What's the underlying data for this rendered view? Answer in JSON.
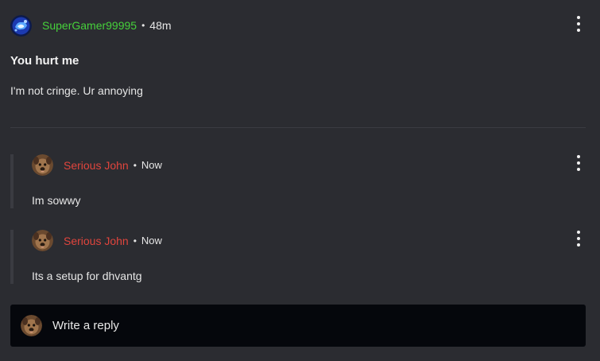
{
  "post": {
    "author": "SuperGamer99995",
    "separator": "•",
    "time": "48m",
    "title": "You hurt me",
    "body": "I'm not cringe. Ur annoying",
    "author_color": "#46d13b"
  },
  "replies": [
    {
      "author": "Serious John",
      "separator": "•",
      "time": "Now",
      "body": "Im sowwy",
      "author_color": "#e0453d"
    },
    {
      "author": "Serious John",
      "separator": "•",
      "time": "Now",
      "body": "Its a setup for dhvantg",
      "author_color": "#e0453d"
    }
  ],
  "reply_box": {
    "placeholder": "Write a reply"
  },
  "icons": {
    "menu": "more-vertical-icon",
    "op_avatar": "gamer-avatar-icon",
    "reply_avatar": "dog-avatar-icon"
  },
  "colors": {
    "background": "#2b2c31",
    "reply_box_background": "#05070c"
  }
}
